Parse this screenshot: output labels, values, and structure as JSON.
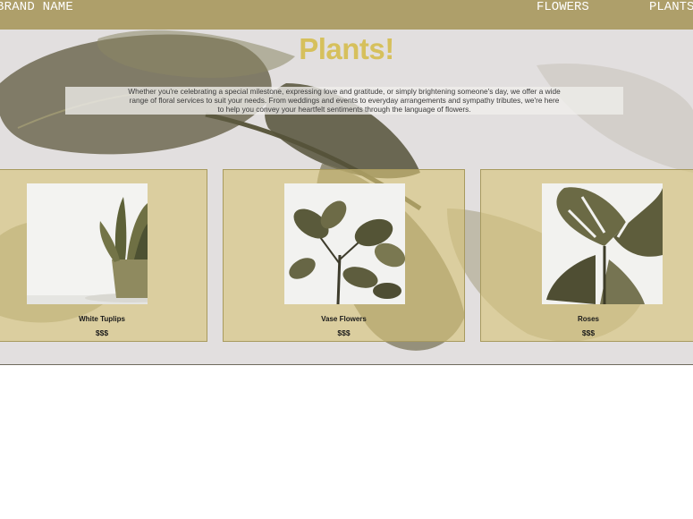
{
  "nav": {
    "brand": "BRAND NAME",
    "links": [
      "FLOWERS",
      "PLANTS"
    ]
  },
  "hero": {
    "title": "Plants!",
    "intro": "Whether you're celebrating a special milestone, expressing love and gratitude, or simply brightening someone's day, we offer a wide range of floral services to suit your needs. From weddings and events to everyday arrangements and sympathy tributes, we're here to help you convey your heartfelt sentiments through the language of flowers."
  },
  "products": [
    {
      "name": "White Tuplips",
      "price": "$$$",
      "image_icon": "potted-snake-plant-icon"
    },
    {
      "name": "Vase Flowers",
      "price": "$$$",
      "image_icon": "fiddle-leaf-fig-icon"
    },
    {
      "name": "Roses",
      "price": "$$$",
      "image_icon": "monstera-leaf-icon"
    }
  ],
  "colors": {
    "navbar": "#ae9f6a",
    "title": "#d6c05c",
    "card": "#d7c478",
    "card_border": "#a89a5e"
  }
}
